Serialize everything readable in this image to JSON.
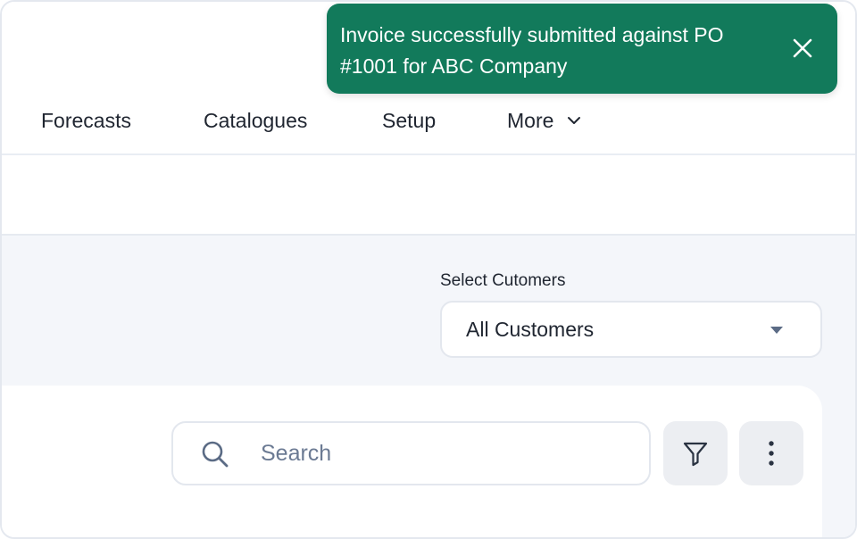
{
  "toast": {
    "message": "Invoice successfully submitted against PO #1001 for ABC Company",
    "color": "#127a5b",
    "close_icon": "close-icon"
  },
  "nav": {
    "items": [
      {
        "label": "Forecasts"
      },
      {
        "label": "Catalogues"
      },
      {
        "label": "Setup"
      },
      {
        "label": "More",
        "icon": "chevron-down-icon"
      }
    ]
  },
  "customer_select": {
    "label": "Select Cutomers",
    "value": "All Customers"
  },
  "toolbar": {
    "search": {
      "placeholder": "Search",
      "value": "",
      "icon": "search-icon"
    },
    "filter_icon": "filter-icon",
    "more_icon": "more-vertical-icon"
  }
}
